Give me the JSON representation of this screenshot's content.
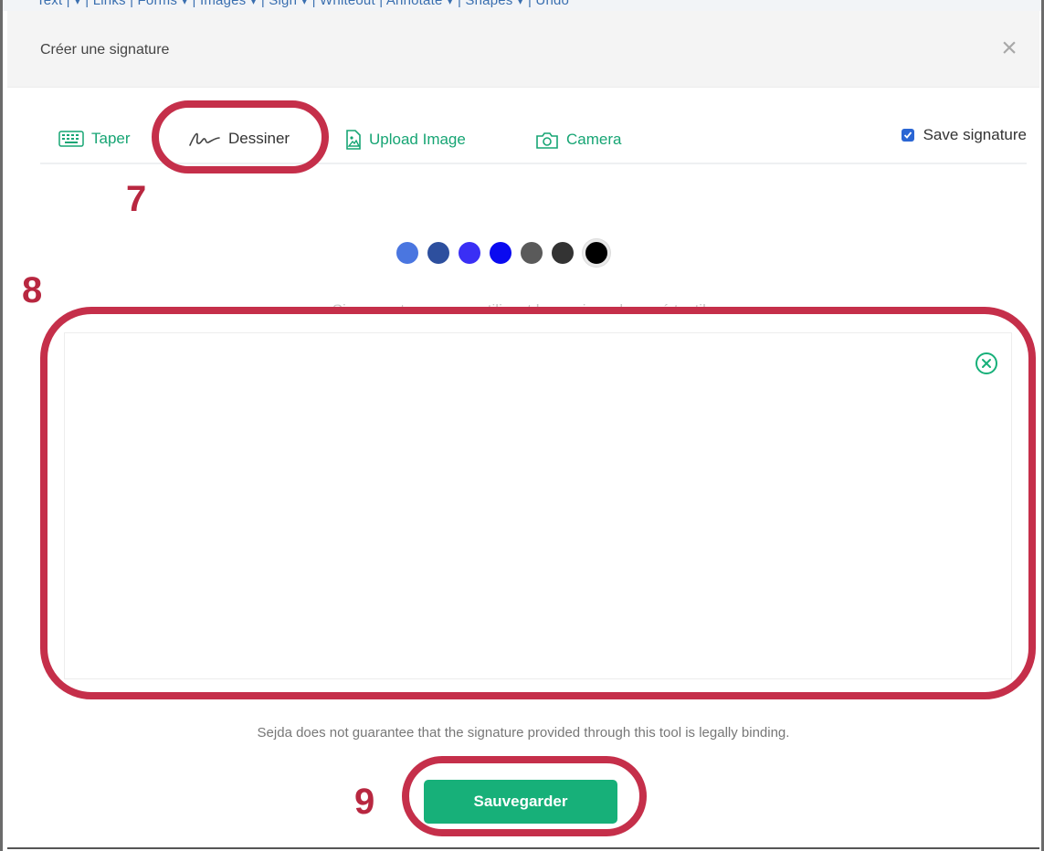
{
  "dialog": {
    "title": "Créer une signature",
    "close_symbol": "×"
  },
  "tabs": [
    {
      "label": "Taper",
      "icon": "keyboard-icon"
    },
    {
      "label": "Dessiner",
      "icon": "signature-icon"
    },
    {
      "label": "Upload Image",
      "icon": "image-file-icon"
    },
    {
      "label": "Camera",
      "icon": "camera-icon"
    }
  ],
  "active_tab": "Dessiner",
  "save_signature": {
    "label": "Save signature",
    "checked": true
  },
  "colors": [
    "#4a76e0",
    "#2d4f9e",
    "#3a2ff5",
    "#0a0af0",
    "#5a5a5a",
    "#333333",
    "#000000"
  ],
  "selected_color": "#000000",
  "canvas": {
    "hint": "Signez votre nom en utilisant la souris ou le pavé tactile"
  },
  "disclaimer": "Sejda does not guarantee that the signature provided through this tool is legally binding.",
  "save_button": {
    "label": "Sauvegarder"
  },
  "annotations": {
    "step_7": "7",
    "step_8": "8",
    "step_9": "9"
  },
  "background_toolbar": "Text | ▾ | Links | Forms ▾ | Images ▾ | Sign ▾ | Whiteout | Annotate ▾ | Shapes ▾ | Undo",
  "accent_color": "#17b079",
  "annotation_color": "#c52f4a"
}
